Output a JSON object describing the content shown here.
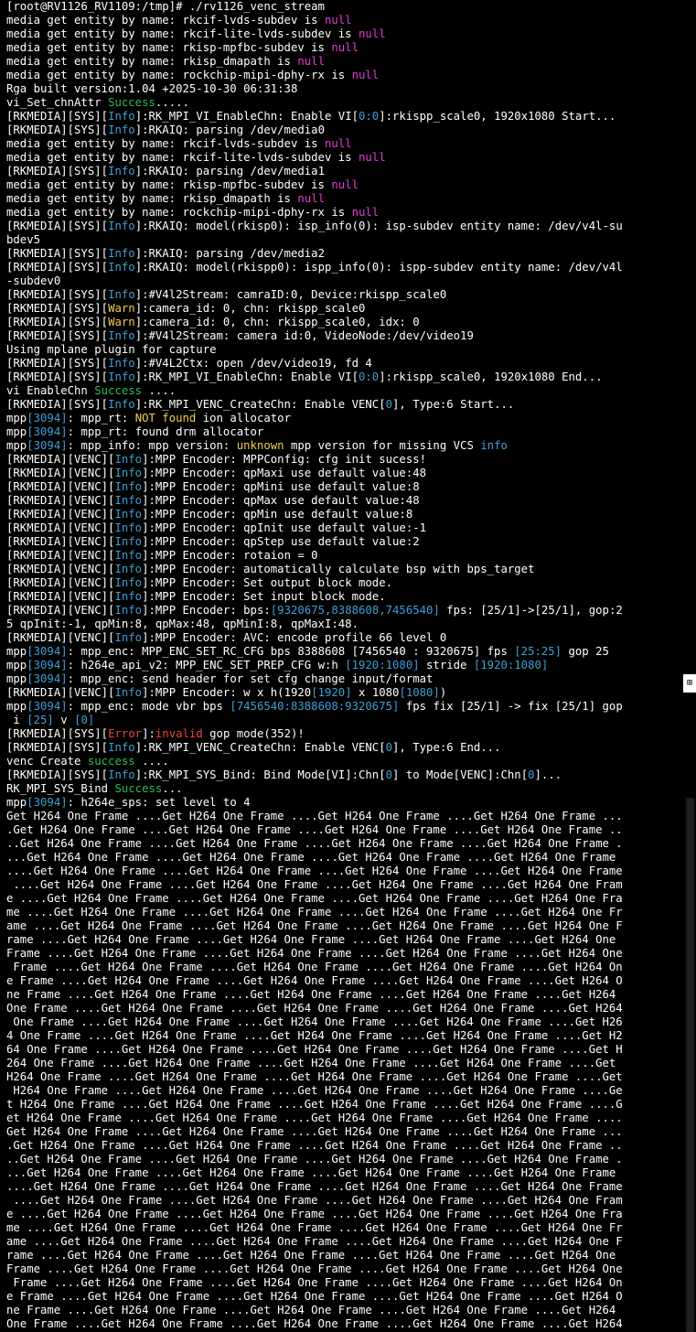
{
  "colors": {
    "background": "#000000",
    "text": "#ffffff",
    "null": "#e23bd3",
    "info": "#3f9fd4",
    "success": "#2dbb4e",
    "warn": "#f1d04b",
    "error": "#f0443a"
  },
  "scroll_marker": "⊞",
  "lines": [
    [
      {
        "t": "[root@RV1126_RV1109:/tmp]# ./rv1126_venc_stream"
      }
    ],
    [
      {
        "t": "media get entity by name: rkcif-lvds-subdev is "
      },
      {
        "t": "null",
        "c": "null"
      }
    ],
    [
      {
        "t": "media get entity by name: rkcif-lite-lvds-subdev is "
      },
      {
        "t": "null",
        "c": "null"
      }
    ],
    [
      {
        "t": "media get entity by name: rkisp-mpfbc-subdev is "
      },
      {
        "t": "null",
        "c": "null"
      }
    ],
    [
      {
        "t": "media get entity by name: rkisp_dmapath is "
      },
      {
        "t": "null",
        "c": "null"
      }
    ],
    [
      {
        "t": "media get entity by name: rockchip-mipi-dphy-rx is "
      },
      {
        "t": "null",
        "c": "null"
      }
    ],
    [
      {
        "t": "Rga built version:1.04 +2025-10-30 06:31:38"
      }
    ],
    [
      {
        "t": "vi_Set_chnAttr "
      },
      {
        "t": "Success",
        "c": "success"
      },
      {
        "t": "....."
      }
    ],
    [
      {
        "t": "[RKMEDIA][SYS]["
      },
      {
        "t": "Info",
        "c": "info"
      },
      {
        "t": "]:RK_MPI_VI_EnableChn: Enable VI["
      },
      {
        "t": "0:0",
        "c": "num"
      },
      {
        "t": "]:rkispp_scale0, 1920x1080 Start..."
      }
    ],
    [
      {
        "t": "[RKMEDIA][SYS]["
      },
      {
        "t": "Info",
        "c": "info"
      },
      {
        "t": "]:RKAIQ: parsing /dev/media0"
      }
    ],
    [
      {
        "t": "media get entity by name: rkcif-lvds-subdev is "
      },
      {
        "t": "null",
        "c": "null"
      }
    ],
    [
      {
        "t": "media get entity by name: rkcif-lite-lvds-subdev is "
      },
      {
        "t": "null",
        "c": "null"
      }
    ],
    [
      {
        "t": "[RKMEDIA][SYS]["
      },
      {
        "t": "Info",
        "c": "info"
      },
      {
        "t": "]:RKAIQ: parsing /dev/media1"
      }
    ],
    [
      {
        "t": "media get entity by name: rkisp-mpfbc-subdev is "
      },
      {
        "t": "null",
        "c": "null"
      }
    ],
    [
      {
        "t": "media get entity by name: rkisp_dmapath is "
      },
      {
        "t": "null",
        "c": "null"
      }
    ],
    [
      {
        "t": "media get entity by name: rockchip-mipi-dphy-rx is "
      },
      {
        "t": "null",
        "c": "null"
      }
    ],
    [
      {
        "t": "[RKMEDIA][SYS]["
      },
      {
        "t": "Info",
        "c": "info"
      },
      {
        "t": "]:RKAIQ: model(rkisp0): isp_info(0): isp-subdev entity name: /dev/v4l-su"
      }
    ],
    [
      {
        "t": "bdev5"
      }
    ],
    [
      {
        "t": "[RKMEDIA][SYS]["
      },
      {
        "t": "Info",
        "c": "info"
      },
      {
        "t": "]:RKAIQ: parsing /dev/media2"
      }
    ],
    [
      {
        "t": "[RKMEDIA][SYS]["
      },
      {
        "t": "Info",
        "c": "info"
      },
      {
        "t": "]:RKAIQ: model(rkispp0): ispp_info(0): ispp-subdev entity name: /dev/v4l"
      }
    ],
    [
      {
        "t": "-subdev0"
      }
    ],
    [
      {
        "t": "[RKMEDIA][SYS]["
      },
      {
        "t": "Info",
        "c": "info"
      },
      {
        "t": "]:#V4l2Stream: camraID:0, Device:rkispp_scale0"
      }
    ],
    [
      {
        "t": "[RKMEDIA][SYS]["
      },
      {
        "t": "Warn",
        "c": "warn"
      },
      {
        "t": "]:camera_id: 0, chn: rkispp_scale0"
      }
    ],
    [
      {
        "t": "[RKMEDIA][SYS]["
      },
      {
        "t": "Warn",
        "c": "warn"
      },
      {
        "t": "]:camera_id: 0, chn: rkispp_scale0, idx: 0"
      }
    ],
    [
      {
        "t": "[RKMEDIA][SYS]["
      },
      {
        "t": "Info",
        "c": "info"
      },
      {
        "t": "]:#V4l2Stream: camera id:0, VideoNode:/dev/video19"
      }
    ],
    [
      {
        "t": "Using mplane plugin for capture"
      }
    ],
    [
      {
        "t": "[RKMEDIA][SYS]["
      },
      {
        "t": "Info",
        "c": "info"
      },
      {
        "t": "]:#V4L2Ctx: open /dev/video19, fd 4"
      }
    ],
    [
      {
        "t": "[RKMEDIA][SYS]["
      },
      {
        "t": "Info",
        "c": "info"
      },
      {
        "t": "]:RK_MPI_VI_EnableChn: Enable VI["
      },
      {
        "t": "0:0",
        "c": "num"
      },
      {
        "t": "]:rkispp_scale0, 1920x1080 End..."
      }
    ],
    [
      {
        "t": "vi EnableChn "
      },
      {
        "t": "Success",
        "c": "success"
      },
      {
        "t": " ...."
      }
    ],
    [
      {
        "t": "[RKMEDIA][SYS]["
      },
      {
        "t": "Info",
        "c": "info"
      },
      {
        "t": "]:RK_MPI_VENC_CreateChn: Enable VENC["
      },
      {
        "t": "0",
        "c": "num"
      },
      {
        "t": "], Type:6 Start..."
      }
    ],
    [
      {
        "t": "mpp"
      },
      {
        "t": "[3094]",
        "c": "pid"
      },
      {
        "t": ": mpp_rt: "
      },
      {
        "t": "NOT found",
        "c": "notfound"
      },
      {
        "t": " ion allocator"
      }
    ],
    [
      {
        "t": "mpp"
      },
      {
        "t": "[3094]",
        "c": "pid"
      },
      {
        "t": ": mpp_rt: found drm allocator"
      }
    ],
    [
      {
        "t": "mpp"
      },
      {
        "t": "[3094]",
        "c": "pid"
      },
      {
        "t": ": mpp_info: mpp version: "
      },
      {
        "t": "unknown",
        "c": "unknown"
      },
      {
        "t": " mpp version for missing VCS "
      },
      {
        "t": "info",
        "c": "info"
      }
    ],
    [
      {
        "t": "[RKMEDIA][VENC]["
      },
      {
        "t": "Info",
        "c": "info"
      },
      {
        "t": "]:MPP Encoder: MPPConfig: cfg init sucess!"
      }
    ],
    [
      {
        "t": "[RKMEDIA][VENC]["
      },
      {
        "t": "Info",
        "c": "info"
      },
      {
        "t": "]:MPP Encoder: qpMaxi use default value:48"
      }
    ],
    [
      {
        "t": "[RKMEDIA][VENC]["
      },
      {
        "t": "Info",
        "c": "info"
      },
      {
        "t": "]:MPP Encoder: qpMini use default value:8"
      }
    ],
    [
      {
        "t": "[RKMEDIA][VENC]["
      },
      {
        "t": "Info",
        "c": "info"
      },
      {
        "t": "]:MPP Encoder: qpMax use default value:48"
      }
    ],
    [
      {
        "t": "[RKMEDIA][VENC]["
      },
      {
        "t": "Info",
        "c": "info"
      },
      {
        "t": "]:MPP Encoder: qpMin use default value:8"
      }
    ],
    [
      {
        "t": "[RKMEDIA][VENC]["
      },
      {
        "t": "Info",
        "c": "info"
      },
      {
        "t": "]:MPP Encoder: qpInit use default value:-1"
      }
    ],
    [
      {
        "t": "[RKMEDIA][VENC]["
      },
      {
        "t": "Info",
        "c": "info"
      },
      {
        "t": "]:MPP Encoder: qpStep use default value:2"
      }
    ],
    [
      {
        "t": "[RKMEDIA][VENC]["
      },
      {
        "t": "Info",
        "c": "info"
      },
      {
        "t": "]:MPP Encoder: rotaion = 0"
      }
    ],
    [
      {
        "t": "[RKMEDIA][VENC]["
      },
      {
        "t": "Info",
        "c": "info"
      },
      {
        "t": "]:MPP Encoder: automatically calculate bsp with bps_target"
      }
    ],
    [
      {
        "t": "[RKMEDIA][VENC]["
      },
      {
        "t": "Info",
        "c": "info"
      },
      {
        "t": "]:MPP Encoder: Set output block mode."
      }
    ],
    [
      {
        "t": "[RKMEDIA][VENC]["
      },
      {
        "t": "Info",
        "c": "info"
      },
      {
        "t": "]:MPP Encoder: Set input block mode."
      }
    ],
    [
      {
        "t": "[RKMEDIA][VENC]["
      },
      {
        "t": "Info",
        "c": "info"
      },
      {
        "t": "]:MPP Encoder: bps:"
      },
      {
        "t": "[9320675,8388608,7456540]",
        "c": "num"
      },
      {
        "t": " fps: [25/1]->[25/1], gop:2"
      }
    ],
    [
      {
        "t": "5 qpInit:-1, qpMin:8, qpMax:48, qpMinI:8, qpMaxI:48."
      }
    ],
    [
      {
        "t": "[RKMEDIA][VENC]["
      },
      {
        "t": "Info",
        "c": "info"
      },
      {
        "t": "]:MPP Encoder: AVC: encode profile 66 level 0"
      }
    ],
    [
      {
        "t": "mpp"
      },
      {
        "t": "[3094]",
        "c": "pid"
      },
      {
        "t": ": mpp_enc: MPP_ENC_SET_RC_CFG bps 8388608 [7456540 : 9320675] fps "
      },
      {
        "t": "[25:25]",
        "c": "num"
      },
      {
        "t": " gop 25"
      }
    ],
    [
      {
        "t": "mpp"
      },
      {
        "t": "[3094]",
        "c": "pid"
      },
      {
        "t": ": h264e_api_v2: MPP_ENC_SET_PREP_CFG w:h "
      },
      {
        "t": "[1920:1080]",
        "c": "num"
      },
      {
        "t": " stride "
      },
      {
        "t": "[1920:1080]",
        "c": "num"
      }
    ],
    [
      {
        "t": "mpp"
      },
      {
        "t": "[3094]",
        "c": "pid"
      },
      {
        "t": ": mpp_enc: send header for set cfg change input/format"
      }
    ],
    [
      {
        "t": "[RKMEDIA][VENC]["
      },
      {
        "t": "Info",
        "c": "info"
      },
      {
        "t": "]:MPP Encoder: w x h(1920"
      },
      {
        "t": "[1920]",
        "c": "num"
      },
      {
        "t": " x 1080"
      },
      {
        "t": "[1080]",
        "c": "num"
      },
      {
        "t": ")"
      }
    ],
    [
      {
        "t": "mpp"
      },
      {
        "t": "[3094]",
        "c": "pid"
      },
      {
        "t": ": mpp_enc: mode vbr bps "
      },
      {
        "t": "[7456540:8388608:9320675]",
        "c": "num"
      },
      {
        "t": " fps fix [25/1] -> fix [25/1] gop"
      }
    ],
    [
      {
        "t": " i "
      },
      {
        "t": "[25]",
        "c": "num"
      },
      {
        "t": " v "
      },
      {
        "t": "[0]",
        "c": "num"
      }
    ],
    [
      {
        "t": "[RKMEDIA][SYS]["
      },
      {
        "t": "Error",
        "c": "error"
      },
      {
        "t": "]:"
      },
      {
        "t": "invalid",
        "c": "error"
      },
      {
        "t": " gop mode(352)!"
      }
    ],
    [
      {
        "t": "[RKMEDIA][SYS]["
      },
      {
        "t": "Info",
        "c": "info"
      },
      {
        "t": "]:RK_MPI_VENC_CreateChn: Enable VENC["
      },
      {
        "t": "0",
        "c": "num"
      },
      {
        "t": "], Type:6 End..."
      }
    ],
    [
      {
        "t": "venc Create "
      },
      {
        "t": "success",
        "c": "success"
      },
      {
        "t": " ...."
      }
    ],
    [
      {
        "t": "[RKMEDIA][SYS]["
      },
      {
        "t": "Info",
        "c": "info"
      },
      {
        "t": "]:RK_MPI_SYS_Bind: Bind Mode[VI]:Chn["
      },
      {
        "t": "0",
        "c": "num"
      },
      {
        "t": "] to Mode[VENC]:Chn["
      },
      {
        "t": "0",
        "c": "num"
      },
      {
        "t": "]..."
      }
    ],
    [
      {
        "t": "RK_MPI_SYS_Bind "
      },
      {
        "t": "Success",
        "c": "success"
      },
      {
        "t": "..."
      }
    ],
    [
      {
        "t": "mpp"
      },
      {
        "t": "[3094]",
        "c": "pid"
      },
      {
        "t": ": h264e_sps: set level to 4"
      }
    ],
    [
      {
        "t": "Get H264 One Frame ....Get H264 One Frame ....Get H264 One Frame ....Get H264 One Frame ..."
      }
    ],
    [
      {
        "t": ".Get H264 One Frame ....Get H264 One Frame ....Get H264 One Frame ....Get H264 One Frame .."
      }
    ],
    [
      {
        "t": "..Get H264 One Frame ....Get H264 One Frame ....Get H264 One Frame ....Get H264 One Frame ."
      }
    ],
    [
      {
        "t": "...Get H264 One Frame ....Get H264 One Frame ....Get H264 One Frame ....Get H264 One Frame"
      }
    ],
    [
      {
        "t": "....Get H264 One Frame ....Get H264 One Frame ....Get H264 One Frame ....Get H264 One Frame"
      }
    ],
    [
      {
        "t": " ....Get H264 One Frame ....Get H264 One Frame ....Get H264 One Frame ....Get H264 One Fram"
      }
    ],
    [
      {
        "t": "e ....Get H264 One Frame ....Get H264 One Frame ....Get H264 One Frame ....Get H264 One Fra"
      }
    ],
    [
      {
        "t": "me ....Get H264 One Frame ....Get H264 One Frame ....Get H264 One Frame ....Get H264 One Fr"
      }
    ],
    [
      {
        "t": "ame ....Get H264 One Frame ....Get H264 One Frame ....Get H264 One Frame ....Get H264 One F"
      }
    ],
    [
      {
        "t": "rame ....Get H264 One Frame ....Get H264 One Frame ....Get H264 One Frame ....Get H264 One"
      }
    ],
    [
      {
        "t": "Frame ....Get H264 One Frame ....Get H264 One Frame ....Get H264 One Frame ....Get H264 One"
      }
    ],
    [
      {
        "t": " Frame ....Get H264 One Frame ....Get H264 One Frame ....Get H264 One Frame ....Get H264 On"
      }
    ],
    [
      {
        "t": "e Frame ....Get H264 One Frame ....Get H264 One Frame ....Get H264 One Frame ....Get H264 O"
      }
    ],
    [
      {
        "t": "ne Frame ....Get H264 One Frame ....Get H264 One Frame ....Get H264 One Frame ....Get H264"
      }
    ],
    [
      {
        "t": "One Frame ....Get H264 One Frame ....Get H264 One Frame ....Get H264 One Frame ....Get H264"
      }
    ],
    [
      {
        "t": " One Frame ....Get H264 One Frame ....Get H264 One Frame ....Get H264 One Frame ....Get H26"
      }
    ],
    [
      {
        "t": "4 One Frame ....Get H264 One Frame ....Get H264 One Frame ....Get H264 One Frame ....Get H2"
      }
    ],
    [
      {
        "t": "64 One Frame ....Get H264 One Frame ....Get H264 One Frame ....Get H264 One Frame ....Get H"
      }
    ],
    [
      {
        "t": "264 One Frame ....Get H264 One Frame ....Get H264 One Frame ....Get H264 One Frame ....Get"
      }
    ],
    [
      {
        "t": "H264 One Frame ....Get H264 One Frame ....Get H264 One Frame ....Get H264 One Frame ....Get"
      }
    ],
    [
      {
        "t": " H264 One Frame ....Get H264 One Frame ....Get H264 One Frame ....Get H264 One Frame ....Ge"
      }
    ],
    [
      {
        "t": "t H264 One Frame ....Get H264 One Frame ....Get H264 One Frame ....Get H264 One Frame ....G"
      }
    ],
    [
      {
        "t": "et H264 One Frame ....Get H264 One Frame ....Get H264 One Frame ....Get H264 One Frame ...."
      }
    ],
    [
      {
        "t": "Get H264 One Frame ....Get H264 One Frame ....Get H264 One Frame ....Get H264 One Frame ..."
      }
    ],
    [
      {
        "t": ".Get H264 One Frame ....Get H264 One Frame ....Get H264 One Frame ....Get H264 One Frame .."
      }
    ],
    [
      {
        "t": "..Get H264 One Frame ....Get H264 One Frame ....Get H264 One Frame ....Get H264 One Frame ."
      }
    ],
    [
      {
        "t": "...Get H264 One Frame ....Get H264 One Frame ....Get H264 One Frame ....Get H264 One Frame"
      }
    ],
    [
      {
        "t": "....Get H264 One Frame ....Get H264 One Frame ....Get H264 One Frame ....Get H264 One Frame"
      }
    ],
    [
      {
        "t": " ....Get H264 One Frame ....Get H264 One Frame ....Get H264 One Frame ....Get H264 One Fram"
      }
    ],
    [
      {
        "t": "e ....Get H264 One Frame ....Get H264 One Frame ....Get H264 One Frame ....Get H264 One Fra"
      }
    ],
    [
      {
        "t": "me ....Get H264 One Frame ....Get H264 One Frame ....Get H264 One Frame ....Get H264 One Fr"
      }
    ],
    [
      {
        "t": "ame ....Get H264 One Frame ....Get H264 One Frame ....Get H264 One Frame ....Get H264 One F"
      }
    ],
    [
      {
        "t": "rame ....Get H264 One Frame ....Get H264 One Frame ....Get H264 One Frame ....Get H264 One"
      }
    ],
    [
      {
        "t": "Frame ....Get H264 One Frame ....Get H264 One Frame ....Get H264 One Frame ....Get H264 One"
      }
    ],
    [
      {
        "t": " Frame ....Get H264 One Frame ....Get H264 One Frame ....Get H264 One Frame ....Get H264 On"
      }
    ],
    [
      {
        "t": "e Frame ....Get H264 One Frame ....Get H264 One Frame ....Get H264 One Frame ....Get H264 O"
      }
    ],
    [
      {
        "t": "ne Frame ....Get H264 One Frame ....Get H264 One Frame ....Get H264 One Frame ....Get H264"
      }
    ],
    [
      {
        "t": "One Frame ....Get H264 One Frame ....Get H264 One Frame ....Get H264 One Frame ....Get H264"
      }
    ]
  ]
}
